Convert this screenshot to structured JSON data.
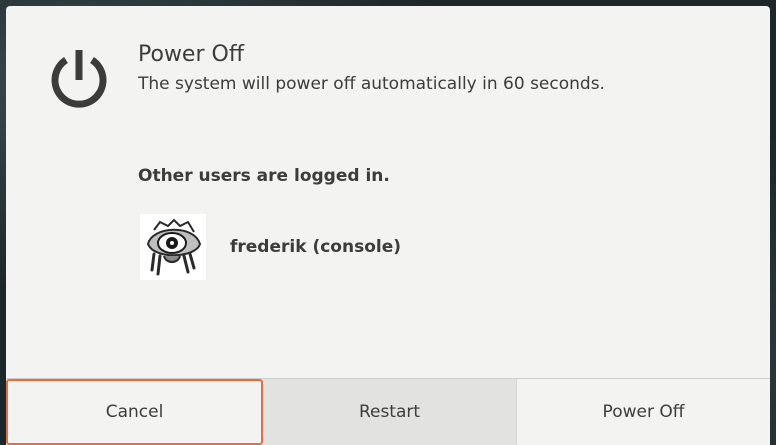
{
  "dialog": {
    "title": "Power Off",
    "message": "The system will power off automatically in 60 seconds.",
    "icon": "power-icon"
  },
  "sessions": {
    "heading": "Other users are logged in.",
    "users": [
      {
        "name": "frederik (console)",
        "avatar": "eye-creature-avatar"
      }
    ]
  },
  "buttons": {
    "cancel": "Cancel",
    "restart": "Restart",
    "power_off": "Power Off"
  },
  "colors": {
    "focus_ring": "#e76c3f",
    "dialog_bg": "#f3f3f2",
    "text": "#3c3c3c"
  }
}
